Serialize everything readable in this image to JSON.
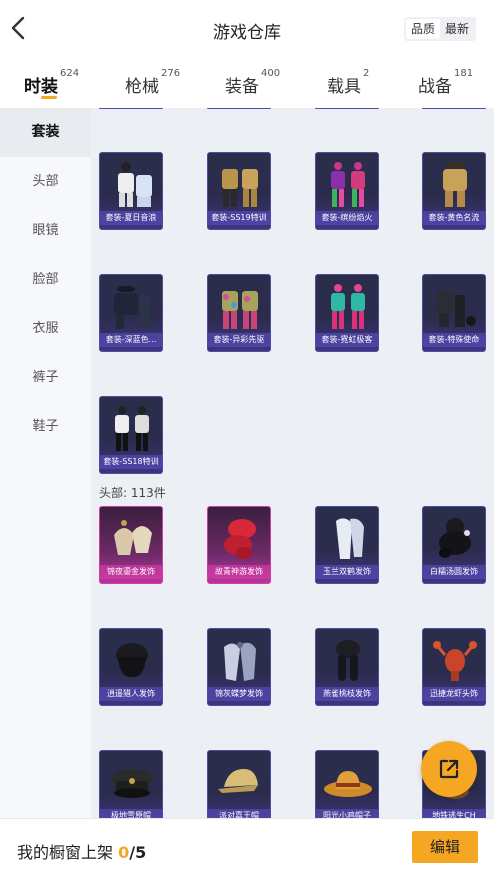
{
  "header": {
    "title": "游戏仓库",
    "sort_options": [
      "品质",
      "最新"
    ],
    "sort_active": "品质"
  },
  "tabs": [
    {
      "label": "时装",
      "count": "624",
      "active": true
    },
    {
      "label": "枪械",
      "count": "276",
      "active": false
    },
    {
      "label": "装备",
      "count": "400",
      "active": false
    },
    {
      "label": "载具",
      "count": "2",
      "active": false
    },
    {
      "label": "战备",
      "count": "181",
      "active": false
    }
  ],
  "sidebar": {
    "items": [
      {
        "label": "套装",
        "active": true
      },
      {
        "label": "头部",
        "active": false
      },
      {
        "label": "眼镜",
        "active": false
      },
      {
        "label": "脸部",
        "active": false
      },
      {
        "label": "衣服",
        "active": false
      },
      {
        "label": "裤子",
        "active": false
      },
      {
        "label": "鞋子",
        "active": false
      }
    ]
  },
  "sets": {
    "items": [
      {
        "label": "套装-夏日音浪",
        "icon": "outfit-white-icon"
      },
      {
        "label": "套装-SS19特训",
        "icon": "outfit-gold-icon"
      },
      {
        "label": "套装-缤纷焰火",
        "icon": "outfit-colorful-icon"
      },
      {
        "label": "套装-黄色名流",
        "icon": "outfit-yellow-icon"
      },
      {
        "label": "套装-深蓝色...",
        "icon": "outfit-navy-icon"
      },
      {
        "label": "套装-异彩先驱",
        "icon": "outfit-pattern-icon"
      },
      {
        "label": "套装-霓虹极客",
        "icon": "outfit-neon-icon"
      },
      {
        "label": "套装-特殊使命",
        "icon": "outfit-dark-icon"
      },
      {
        "label": "套装-SS18特训",
        "icon": "outfit-black-white-icon"
      }
    ]
  },
  "head": {
    "section_title": "头部: 113件",
    "items": [
      {
        "label": "锦夜鎏金发饰",
        "icon": "hair-ornament-icon",
        "quality": "legendary"
      },
      {
        "label": "故青神游发饰",
        "icon": "red-hair-icon",
        "quality": "legendary"
      },
      {
        "label": "玉兰双鹤发饰",
        "icon": "white-hair-icon",
        "quality": "epic"
      },
      {
        "label": "白糯汤圆发饰",
        "icon": "bun-hair-icon",
        "quality": "epic"
      },
      {
        "label": "逍遥猎人发饰",
        "icon": "short-hair-icon",
        "quality": "epic"
      },
      {
        "label": "锦灰蝶梦发饰",
        "icon": "silver-hair-icon",
        "quality": "epic"
      },
      {
        "label": "燕雀桃枝发饰",
        "icon": "braid-hair-icon",
        "quality": "epic"
      },
      {
        "label": "迅捷龙虾头饰",
        "icon": "lobster-headwear-icon",
        "quality": "epic"
      },
      {
        "label": "极地雪原帽",
        "icon": "officer-cap-icon",
        "quality": "epic"
      },
      {
        "label": "派对嘉王帽",
        "icon": "cap-icon",
        "quality": "epic"
      },
      {
        "label": "阳光小鸡帽子",
        "icon": "cowboy-hat-icon",
        "quality": "epic"
      },
      {
        "label": "地铁逃生CH",
        "icon": "antler-headwear-icon",
        "quality": "epic"
      }
    ]
  },
  "bottom_bar": {
    "label": "我的橱窗上架",
    "current": "0",
    "separator_total": "/5",
    "edit_label": "编辑"
  },
  "colors": {
    "accent": "#f5a623",
    "epic_card": "#3e3480",
    "legendary_card": "#b8359c"
  }
}
